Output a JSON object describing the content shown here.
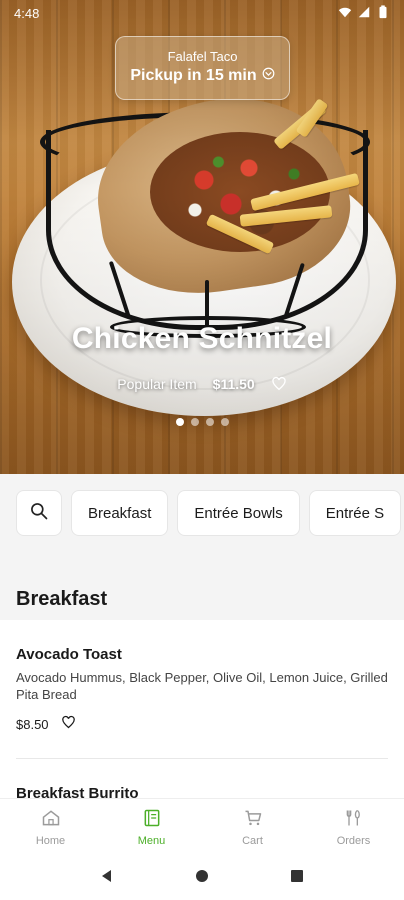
{
  "status_bar": {
    "time": "4:48",
    "icons": [
      "wifi-icon",
      "signal-icon",
      "battery-icon"
    ]
  },
  "hero": {
    "pickup_item": "Falafel Taco",
    "pickup_time": "Pickup in 15 min",
    "title": "Chicken Schnitzel",
    "tag": "Popular Item",
    "price": "$11.50",
    "carousel_pages": 4,
    "carousel_active": 1
  },
  "categories": {
    "search_icon": "search-icon",
    "items": [
      "Breakfast",
      "Entrée Bowls",
      "Entrée S"
    ]
  },
  "menu": {
    "section_title": "Breakfast",
    "items": [
      {
        "name": "Avocado Toast",
        "description": "Avocado Hummus, Black Pepper, Olive Oil, Lemon Juice, Grilled Pita Bread",
        "price": "$8.50"
      },
      {
        "name": "Breakfast Burrito",
        "description": "",
        "price": ""
      }
    ]
  },
  "bottom_nav": {
    "active": "Menu",
    "items": [
      {
        "label": "Home",
        "icon": "home-icon"
      },
      {
        "label": "Menu",
        "icon": "menu-book-icon"
      },
      {
        "label": "Cart",
        "icon": "cart-icon"
      },
      {
        "label": "Orders",
        "icon": "orders-icon"
      }
    ]
  },
  "colors": {
    "accent": "#4caf29",
    "chip_bg": "#f4f4f4",
    "text": "#1a1a1a"
  }
}
